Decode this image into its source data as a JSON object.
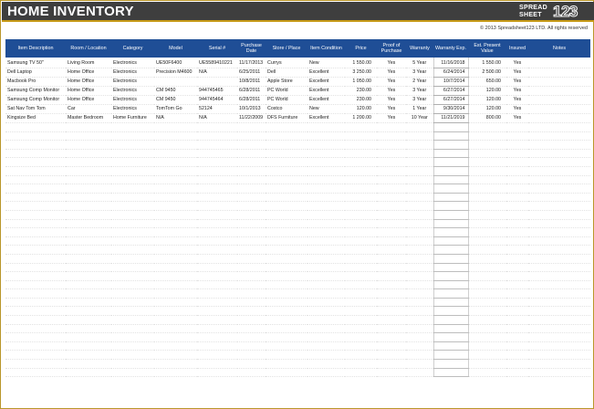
{
  "header": {
    "title": "HOME INVENTORY",
    "logo_line1": "SPREAD",
    "logo_line2": "SHEET",
    "logo_number": "123",
    "copyright": "© 2013 Spreadsheet123 LTD. All rights reserved"
  },
  "colors": {
    "title_bar": "#3e3e3e",
    "accent_gold": "#c79a18",
    "header_blue": "#1f4e96"
  },
  "table": {
    "columns": [
      "Item Description",
      "Room / Location",
      "Category",
      "Model",
      "Serial #",
      "Purchase Date",
      "Store / Place",
      "Item Condition",
      "Price",
      "Proof of Purchase",
      "Warranty",
      "Warranty Exp.",
      "Est. Present Value",
      "Insured",
      "Notes"
    ],
    "rows": [
      [
        "Samsung TV 50\"",
        "Living Room",
        "Electronics",
        "UE50F6400",
        "UE5589410221",
        "11/17/2013",
        "Currys",
        "New",
        "1 550.00",
        "Yes",
        "5 Year",
        "11/16/2018",
        "1 550.00",
        "Yes",
        ""
      ],
      [
        "Dell Laptop",
        "Home Office",
        "Electronics",
        "Precision M4600",
        "N/A",
        "6/25/2011",
        "Dell",
        "Excellent",
        "3 250.00",
        "Yes",
        "3 Year",
        "6/24/2014",
        "2 500.00",
        "Yes",
        ""
      ],
      [
        "Macbook Pro",
        "Home Office",
        "Electronics",
        "",
        "",
        "10/8/2011",
        "Apple Store",
        "Excellent",
        "1 050.00",
        "Yes",
        "2 Year",
        "10/7/2014",
        "650.00",
        "Yes",
        ""
      ],
      [
        "Samsung Comp Monitor",
        "Home Office",
        "Electronics",
        "CM 9450",
        "944745465",
        "6/28/2011",
        "PC World",
        "Excellent",
        "230.00",
        "Yes",
        "3 Year",
        "6/27/2014",
        "120.00",
        "Yes",
        ""
      ],
      [
        "Samsung Comp Monitor",
        "Home Office",
        "Electronics",
        "CM 9450",
        "944745464",
        "6/28/2011",
        "PC World",
        "Excellent",
        "230.00",
        "Yes",
        "3 Year",
        "6/27/2014",
        "120.00",
        "Yes",
        ""
      ],
      [
        "Sat Nav Tom Tom",
        "Car",
        "Electronics",
        "TomTom Go",
        "52124",
        "10/1/2013",
        "Costco",
        "New",
        "120.00",
        "Yes",
        "1 Year",
        "9/30/2014",
        "120.00",
        "Yes",
        ""
      ],
      [
        "Kingsize Bed",
        "Master Bedroom",
        "Home Furniture",
        "N/A",
        "N/A",
        "11/22/2009",
        "DFS Furniture",
        "Excellent",
        "1 200.00",
        "Yes",
        "10 Year",
        "11/21/2019",
        "800.00",
        "Yes",
        ""
      ]
    ]
  }
}
